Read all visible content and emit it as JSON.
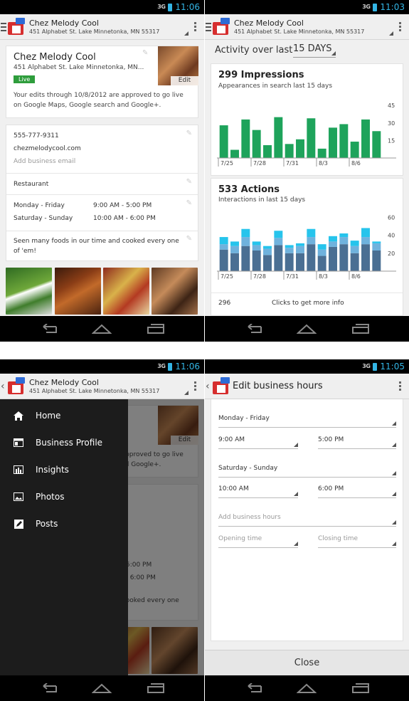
{
  "status": {
    "time1": "11:06",
    "time2": "11:03",
    "time3": "11:06",
    "time4": "11:05",
    "net": "3G"
  },
  "business": {
    "name": "Chez Melody Cool",
    "address": "451 Alphabet St. Lake Minnetonka, MN 55317",
    "address_short": "451 Alphabet St. Lake Minnetonka, MN...",
    "status_badge": "Live",
    "edit_label": "Edit",
    "approval_text": "Your edits through 10/8/2012 are approved to go live on Google Maps, Google search and Google+.",
    "phone": "555-777-9311",
    "website": "chezmelodycool.com",
    "email_placeholder": "Add business email",
    "category": "Restaurant",
    "hours": [
      {
        "days": "Monday - Friday",
        "time": "9:00 AM - 5:00 PM"
      },
      {
        "days": "Saturday - Sunday",
        "time": "10:00 AM - 6:00 PM"
      }
    ],
    "description": "Seen many foods in our time and cooked every one of 'em!"
  },
  "insights": {
    "activity_label": "Activity over last",
    "period": "15 DAYS",
    "impressions": {
      "title": "299 Impressions",
      "subtitle": "Appearances in search last 15 days",
      "y_ticks": [
        "45",
        "30",
        "15"
      ],
      "x_ticks": [
        "7/25",
        "7/28",
        "7/31",
        "8/3",
        "8/6"
      ]
    },
    "actions": {
      "title": "533 Actions",
      "subtitle": "Interactions in last 15 days",
      "y_ticks": [
        "60",
        "40",
        "20"
      ],
      "x_ticks": [
        "7/25",
        "7/28",
        "7/31",
        "8/3",
        "8/6"
      ]
    },
    "footer": {
      "count": "296",
      "label": "Clicks to get more info"
    }
  },
  "chart_data": [
    {
      "type": "bar",
      "title": "299 Impressions",
      "subtitle": "Appearances in search last 15 days",
      "x": [
        "7/25",
        "7/26",
        "7/27",
        "7/28",
        "7/29",
        "7/30",
        "7/31",
        "8/1",
        "8/2",
        "8/3",
        "8/4",
        "8/5",
        "8/6",
        "8/7",
        "8/8"
      ],
      "values": [
        28,
        7,
        33,
        24,
        11,
        35,
        12,
        16,
        34,
        8,
        26,
        29,
        14,
        33,
        23
      ],
      "ylim": [
        0,
        50
      ],
      "color": "#1ea35b"
    },
    {
      "type": "bar",
      "title": "533 Actions",
      "subtitle": "Interactions in last 15 days",
      "x": [
        "7/25",
        "7/26",
        "7/27",
        "7/28",
        "7/29",
        "7/30",
        "7/31",
        "8/1",
        "8/2",
        "8/3",
        "8/4",
        "8/5",
        "8/6",
        "8/7",
        "8/8"
      ],
      "series": [
        {
          "name": "",
          "color": "#4a6f93",
          "values": [
            24,
            20,
            28,
            23,
            18,
            29,
            20,
            20,
            30,
            17,
            27,
            30,
            20,
            30,
            23
          ]
        },
        {
          "name": "",
          "color": "#6fb2dd",
          "values": [
            6,
            8,
            10,
            6,
            7,
            8,
            6,
            8,
            8,
            7,
            6,
            8,
            8,
            8,
            8
          ]
        },
        {
          "name": "",
          "color": "#26c4ec",
          "values": [
            8,
            5,
            9,
            4,
            3,
            8,
            3,
            3,
            9,
            6,
            6,
            4,
            6,
            10,
            2
          ]
        }
      ],
      "ylim": [
        0,
        65
      ]
    }
  ],
  "drawer": {
    "items": [
      {
        "label": "Home",
        "icon": "home-icon"
      },
      {
        "label": "Business Profile",
        "icon": "profile-icon"
      },
      {
        "label": "Insights",
        "icon": "insights-icon"
      },
      {
        "label": "Photos",
        "icon": "photos-icon"
      },
      {
        "label": "Posts",
        "icon": "posts-icon"
      }
    ]
  },
  "edit_hours": {
    "title": "Edit business hours",
    "rows": [
      {
        "days": "Monday - Friday",
        "open": "9:00 AM",
        "close": "5:00 PM"
      },
      {
        "days": "Saturday - Sunday",
        "open": "10:00 AM",
        "close": "6:00 PM"
      }
    ],
    "add_placeholder": "Add business hours",
    "open_placeholder": "Opening time",
    "close_placeholder": "Closing time",
    "close_button": "Close"
  },
  "colors": {
    "accent": "#33b5e5",
    "live": "#2e9d3c",
    "impressions": "#1ea35b",
    "app_red": "#d62e2e",
    "app_blue": "#2e6bd6"
  }
}
